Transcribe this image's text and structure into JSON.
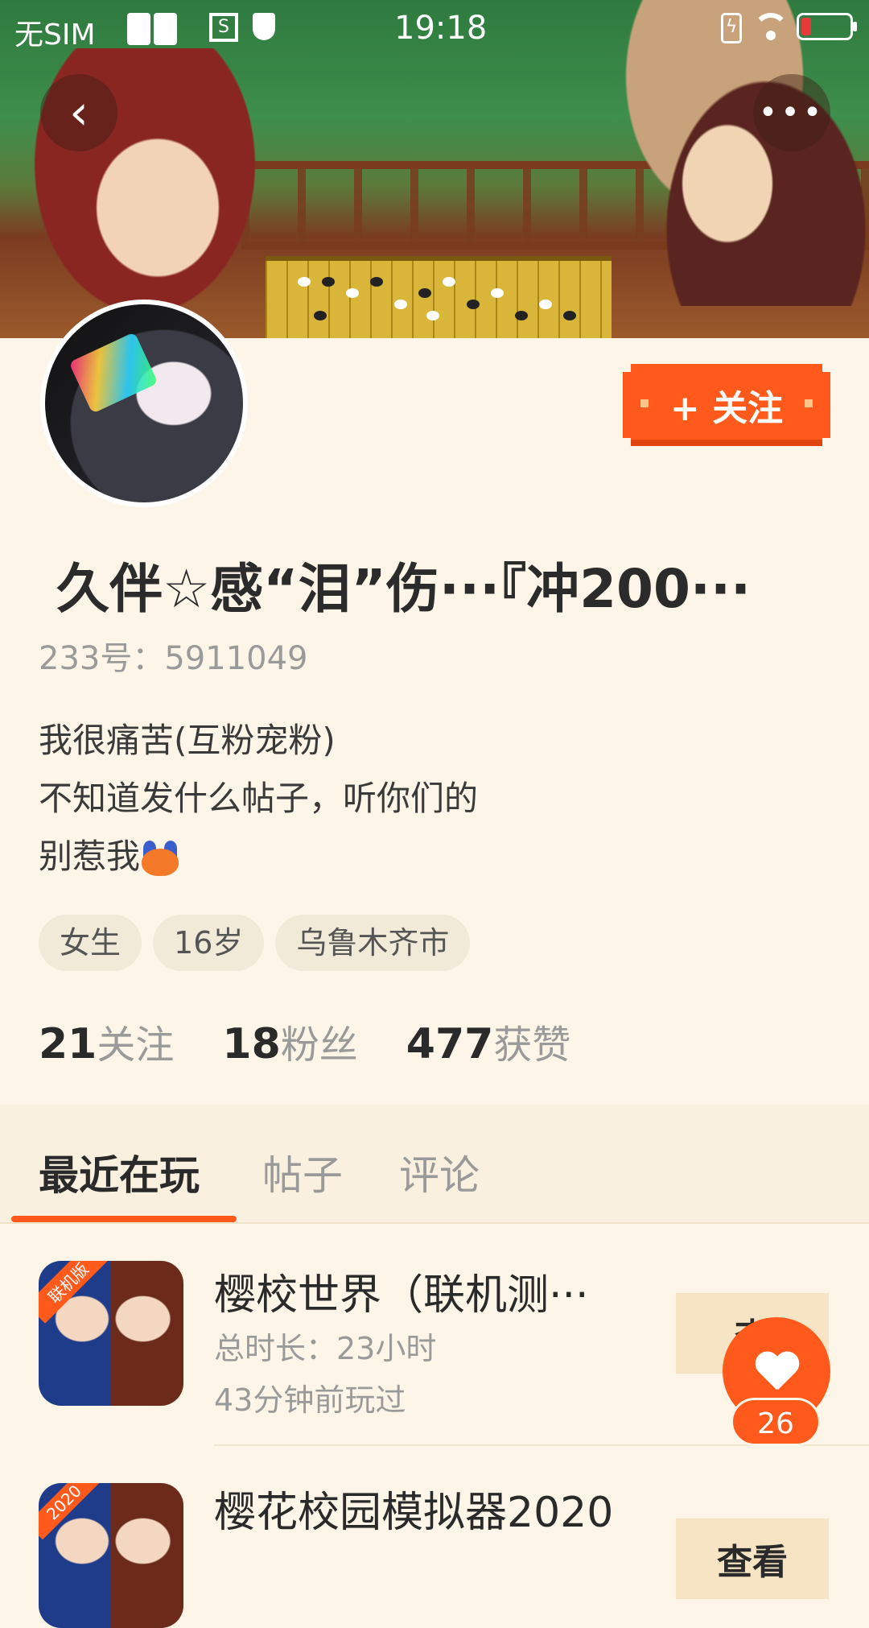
{
  "status_bar": {
    "carrier": "无SIM",
    "time": "19:18"
  },
  "header": {
    "back_icon": "chevron-left-icon",
    "more_icon": "more-dots-icon"
  },
  "profile": {
    "follow_label": "+ 关注",
    "name": "久伴☆感“泪”伤···『冲200···",
    "uid": "233号：5911049",
    "bio_lines": [
      "我很痛苦(互粉宠粉)",
      "不知道发什么帖子，听你们的",
      "别惹我"
    ],
    "tags": [
      "女生",
      "16岁",
      "乌鲁木齐市"
    ],
    "stats": {
      "following_count": "21",
      "following_label": "关注",
      "fans_count": "18",
      "fans_label": "粉丝",
      "likes_count": "477",
      "likes_label": "获赞"
    }
  },
  "tabs": [
    {
      "label": "最近在玩",
      "active": true
    },
    {
      "label": "帖子",
      "active": false
    },
    {
      "label": "评论",
      "active": false
    }
  ],
  "games": [
    {
      "title": "樱校世界（联机测···",
      "badge": "联机版",
      "duration": "总时长：23小时",
      "last_played": "43分钟前玩过",
      "button": "查"
    },
    {
      "title": "樱花校园模拟器2020",
      "badge": "2020",
      "button": "查看"
    }
  ],
  "like_fab": {
    "icon": "heart-icon",
    "count": "26"
  },
  "colors": {
    "accent": "#ff5a1c",
    "background": "#fdf6e8"
  }
}
